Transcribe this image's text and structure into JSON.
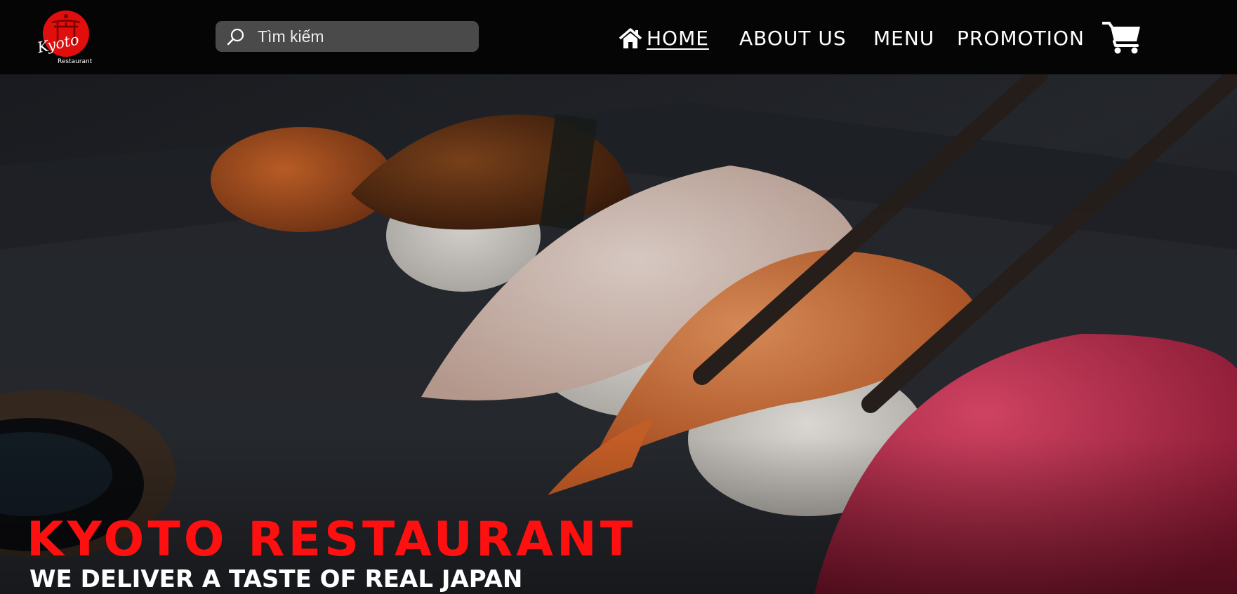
{
  "brand": {
    "logo_text": "Kyoto",
    "logo_subtext": "Restaurant",
    "accent": "#ff1010"
  },
  "search": {
    "placeholder": "Tìm kiếm",
    "value": ""
  },
  "nav": {
    "home_label": "HOME",
    "about_label": "ABOUT US",
    "menu_label": "MENU",
    "promotion_label": "PROMOTION",
    "active": "HOME"
  },
  "hero": {
    "title": "KYOTO RESTAURANT",
    "tagline": "WE DELIVER A TASTE OF REAL JAPAN"
  },
  "icons": {
    "search": "search-icon",
    "home": "home-icon",
    "cart": "cart-icon"
  },
  "colors": {
    "header_bg": "#050505",
    "search_bg": "#4a4a4a",
    "title_red": "#ff1010",
    "text_white": "#ffffff"
  }
}
